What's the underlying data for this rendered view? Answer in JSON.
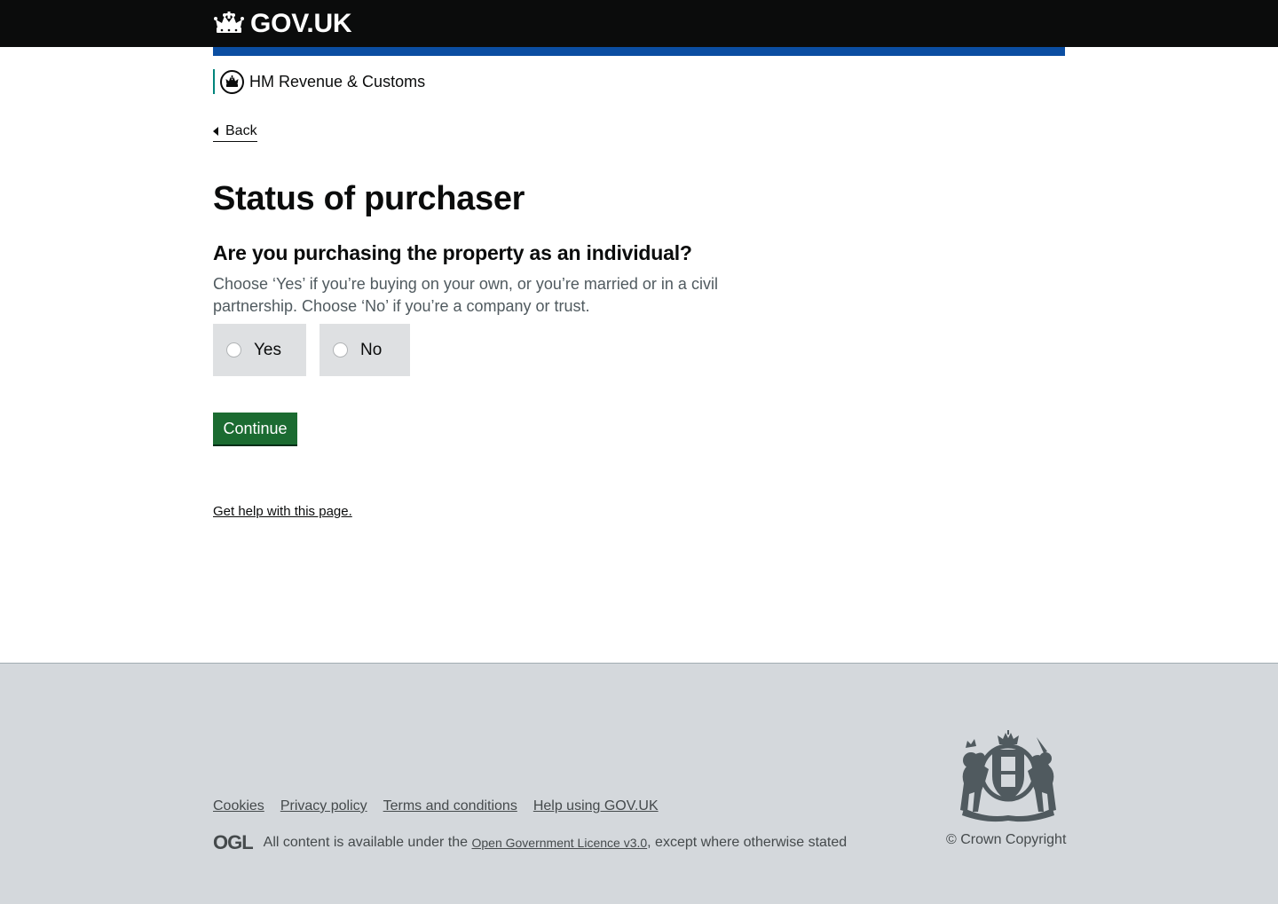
{
  "header": {
    "logo_text": "GOV.UK",
    "crown_icon": "crown-icon"
  },
  "org": {
    "name": "HM Revenue & Customs",
    "crest_icon": "hmrc-crest-icon",
    "accent_color": "#00857c"
  },
  "back_link": {
    "label": "Back"
  },
  "page_title": "Status of purchaser",
  "question": {
    "heading": "Are you purchasing the property as an individual?",
    "hint": "Choose ‘Yes’ if you’re buying on your own, or you’re married or in a civil partnership. Choose ‘No’ if you’re a company or trust.",
    "options": [
      {
        "label": "Yes",
        "selected": false
      },
      {
        "label": "No",
        "selected": false
      }
    ]
  },
  "continue_label": "Continue",
  "help_link": "Get help with this page.",
  "footer": {
    "links": [
      "Cookies",
      "Privacy policy",
      "Terms and conditions",
      "Help using GOV.UK"
    ],
    "ogl_logo": "OGL",
    "licence_prefix": "All content is available under the ",
    "licence_link": "Open Government Licence v3.0",
    "licence_suffix": ", except where otherwise stated",
    "copyright": "© Crown Copyright",
    "crest_icon": "royal-coat-of-arms-icon"
  },
  "colors": {
    "header_bg": "#0b0c0c",
    "blue_bar": "#0b4ea2",
    "button_green": "#1b6b31",
    "footer_bg": "#d4d8dc"
  }
}
